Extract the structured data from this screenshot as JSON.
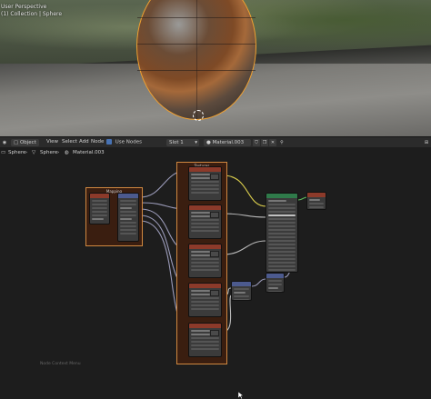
{
  "viewport": {
    "lines": [
      "User Perspective",
      "(1) Collection | Sphere"
    ]
  },
  "header": {
    "mode_label": "Object",
    "menu": [
      "View",
      "Select",
      "Add",
      "Node"
    ],
    "use_nodes_label": "Use Nodes",
    "slot_label": "Slot 1",
    "material_name": "Material.003"
  },
  "breadcrumb": {
    "items": [
      "Sphere",
      "Sphere",
      "Material.003"
    ]
  },
  "frames": {
    "left_label": "Mapping",
    "center_label": "Textures"
  },
  "footer": {
    "text": "Node Context Menu"
  },
  "colors": {
    "accent": "#4772b3",
    "selection": "#f0a030",
    "frame_border": "#d08840",
    "frame_fill": "#3a1e10"
  }
}
